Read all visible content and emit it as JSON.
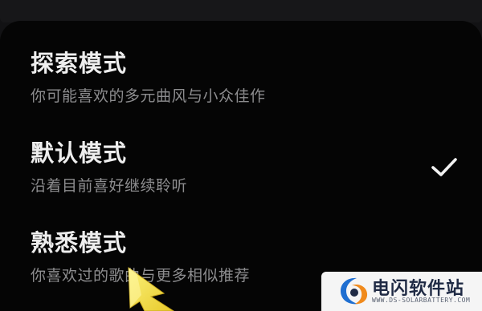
{
  "options": [
    {
      "title": "探索模式",
      "description": "你可能喜欢的多元曲风与小众佳作",
      "selected": false
    },
    {
      "title": "默认模式",
      "description": "沿着目前喜好继续聆听",
      "selected": true
    },
    {
      "title": "熟悉模式",
      "description": "你喜欢过的歌曲与更多相似推荐",
      "selected": false
    }
  ],
  "watermark": {
    "name": "电闪软件站",
    "url": "WWW.DS-SOLARBATTERY.COM"
  },
  "icons": {
    "selected_indicator": "checkmark-icon",
    "pointer": "arrow-pointer-icon",
    "watermark_logo": "ds-logo"
  },
  "colors": {
    "background": "#050505",
    "title_text": "#eeeeee",
    "description_text": "#8d8d8f",
    "checkmark": "#f2f2f2",
    "pointer_arrow": "#f7e646",
    "watermark_text": "#1f2a44"
  }
}
